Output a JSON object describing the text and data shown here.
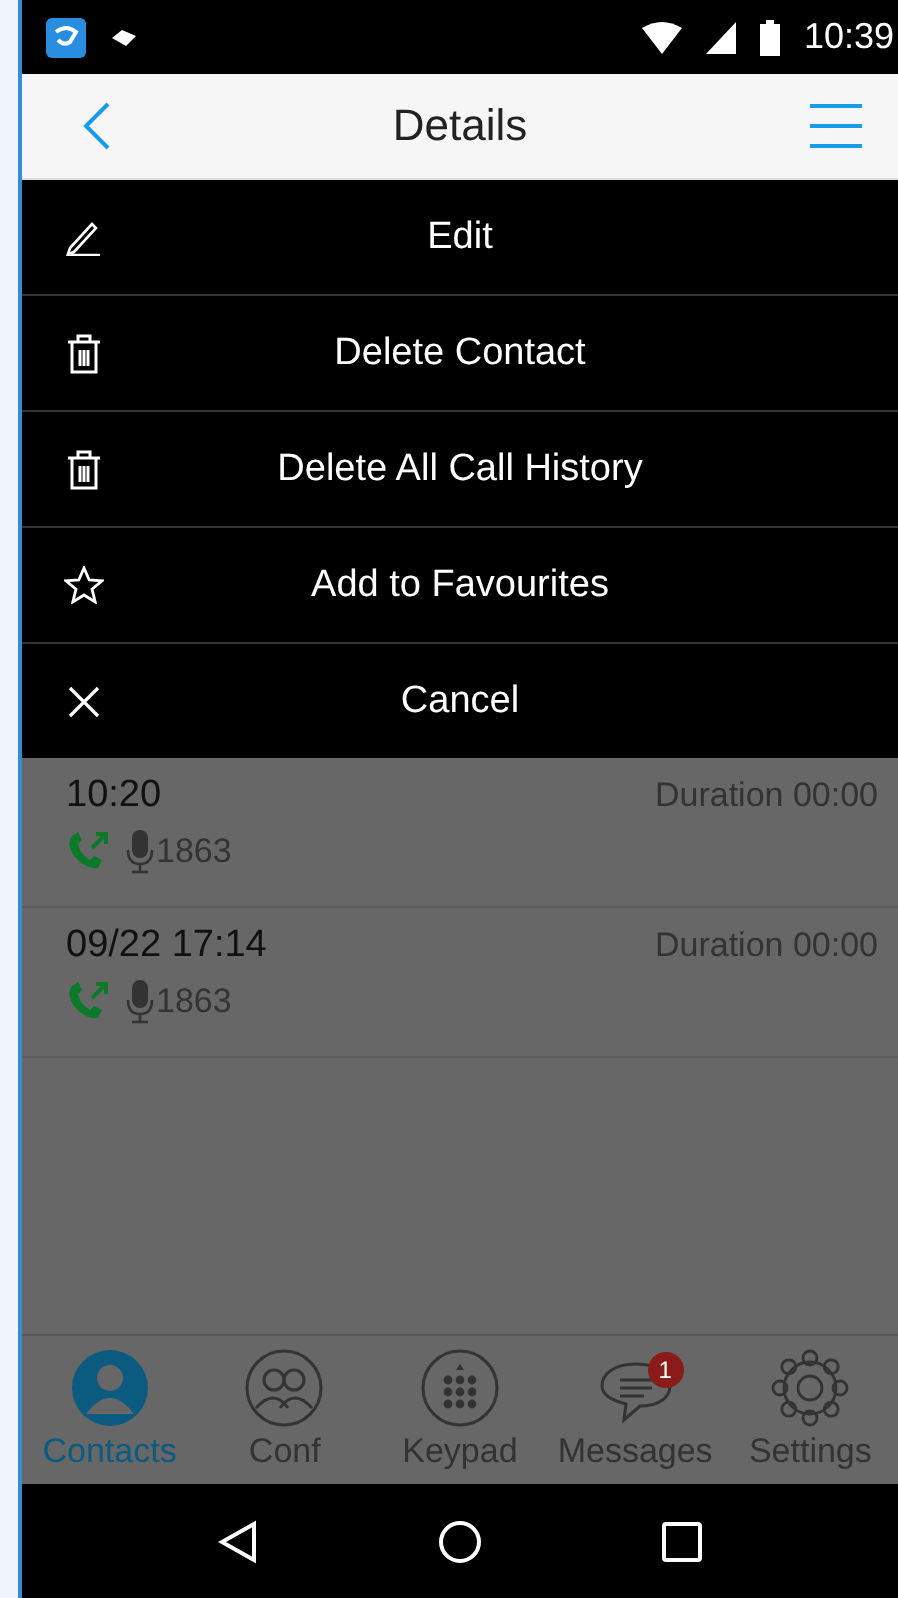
{
  "status_bar": {
    "time": "10:39"
  },
  "header": {
    "title": "Details"
  },
  "action_menu": [
    {
      "kind": "edit",
      "label": "Edit"
    },
    {
      "kind": "delete",
      "label": "Delete Contact"
    },
    {
      "kind": "delete",
      "label": "Delete All Call History"
    },
    {
      "kind": "favourite",
      "label": "Add to Favourites"
    },
    {
      "kind": "cancel",
      "label": "Cancel"
    }
  ],
  "call_history": [
    {
      "time": "10:20",
      "duration": "Duration 00:00",
      "number": "1863"
    },
    {
      "time": "09/22 17:14",
      "duration": "Duration 00:00",
      "number": "1863"
    }
  ],
  "tabs": [
    {
      "kind": "contacts",
      "label": "Contacts",
      "selected": true
    },
    {
      "kind": "conf",
      "label": "Conf",
      "selected": false
    },
    {
      "kind": "keypad",
      "label": "Keypad",
      "selected": false
    },
    {
      "kind": "messages",
      "label": "Messages",
      "selected": false,
      "badge": "1"
    },
    {
      "kind": "settings",
      "label": "Settings",
      "selected": false
    }
  ]
}
